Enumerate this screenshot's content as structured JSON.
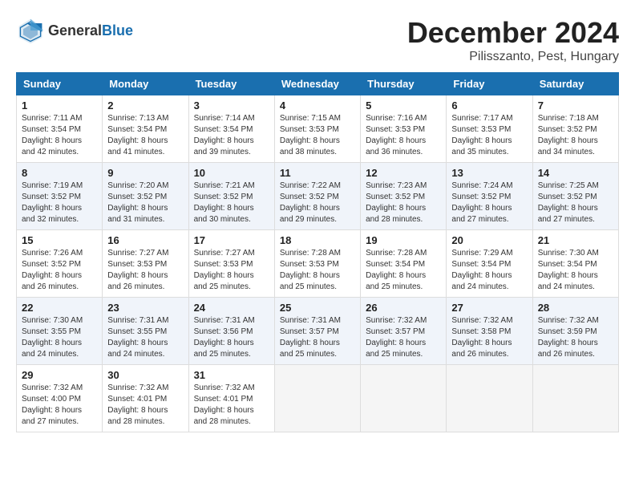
{
  "logo": {
    "general": "General",
    "blue": "Blue"
  },
  "header": {
    "month": "December 2024",
    "location": "Pilisszanto, Pest, Hungary"
  },
  "weekdays": [
    "Sunday",
    "Monday",
    "Tuesday",
    "Wednesday",
    "Thursday",
    "Friday",
    "Saturday"
  ],
  "weeks": [
    [
      {
        "day": "1",
        "info": "Sunrise: 7:11 AM\nSunset: 3:54 PM\nDaylight: 8 hours\nand 42 minutes."
      },
      {
        "day": "2",
        "info": "Sunrise: 7:13 AM\nSunset: 3:54 PM\nDaylight: 8 hours\nand 41 minutes."
      },
      {
        "day": "3",
        "info": "Sunrise: 7:14 AM\nSunset: 3:54 PM\nDaylight: 8 hours\nand 39 minutes."
      },
      {
        "day": "4",
        "info": "Sunrise: 7:15 AM\nSunset: 3:53 PM\nDaylight: 8 hours\nand 38 minutes."
      },
      {
        "day": "5",
        "info": "Sunrise: 7:16 AM\nSunset: 3:53 PM\nDaylight: 8 hours\nand 36 minutes."
      },
      {
        "day": "6",
        "info": "Sunrise: 7:17 AM\nSunset: 3:53 PM\nDaylight: 8 hours\nand 35 minutes."
      },
      {
        "day": "7",
        "info": "Sunrise: 7:18 AM\nSunset: 3:52 PM\nDaylight: 8 hours\nand 34 minutes."
      }
    ],
    [
      {
        "day": "8",
        "info": "Sunrise: 7:19 AM\nSunset: 3:52 PM\nDaylight: 8 hours\nand 32 minutes."
      },
      {
        "day": "9",
        "info": "Sunrise: 7:20 AM\nSunset: 3:52 PM\nDaylight: 8 hours\nand 31 minutes."
      },
      {
        "day": "10",
        "info": "Sunrise: 7:21 AM\nSunset: 3:52 PM\nDaylight: 8 hours\nand 30 minutes."
      },
      {
        "day": "11",
        "info": "Sunrise: 7:22 AM\nSunset: 3:52 PM\nDaylight: 8 hours\nand 29 minutes."
      },
      {
        "day": "12",
        "info": "Sunrise: 7:23 AM\nSunset: 3:52 PM\nDaylight: 8 hours\nand 28 minutes."
      },
      {
        "day": "13",
        "info": "Sunrise: 7:24 AM\nSunset: 3:52 PM\nDaylight: 8 hours\nand 27 minutes."
      },
      {
        "day": "14",
        "info": "Sunrise: 7:25 AM\nSunset: 3:52 PM\nDaylight: 8 hours\nand 27 minutes."
      }
    ],
    [
      {
        "day": "15",
        "info": "Sunrise: 7:26 AM\nSunset: 3:52 PM\nDaylight: 8 hours\nand 26 minutes."
      },
      {
        "day": "16",
        "info": "Sunrise: 7:27 AM\nSunset: 3:53 PM\nDaylight: 8 hours\nand 26 minutes."
      },
      {
        "day": "17",
        "info": "Sunrise: 7:27 AM\nSunset: 3:53 PM\nDaylight: 8 hours\nand 25 minutes."
      },
      {
        "day": "18",
        "info": "Sunrise: 7:28 AM\nSunset: 3:53 PM\nDaylight: 8 hours\nand 25 minutes."
      },
      {
        "day": "19",
        "info": "Sunrise: 7:28 AM\nSunset: 3:54 PM\nDaylight: 8 hours\nand 25 minutes."
      },
      {
        "day": "20",
        "info": "Sunrise: 7:29 AM\nSunset: 3:54 PM\nDaylight: 8 hours\nand 24 minutes."
      },
      {
        "day": "21",
        "info": "Sunrise: 7:30 AM\nSunset: 3:54 PM\nDaylight: 8 hours\nand 24 minutes."
      }
    ],
    [
      {
        "day": "22",
        "info": "Sunrise: 7:30 AM\nSunset: 3:55 PM\nDaylight: 8 hours\nand 24 minutes."
      },
      {
        "day": "23",
        "info": "Sunrise: 7:31 AM\nSunset: 3:55 PM\nDaylight: 8 hours\nand 24 minutes."
      },
      {
        "day": "24",
        "info": "Sunrise: 7:31 AM\nSunset: 3:56 PM\nDaylight: 8 hours\nand 25 minutes."
      },
      {
        "day": "25",
        "info": "Sunrise: 7:31 AM\nSunset: 3:57 PM\nDaylight: 8 hours\nand 25 minutes."
      },
      {
        "day": "26",
        "info": "Sunrise: 7:32 AM\nSunset: 3:57 PM\nDaylight: 8 hours\nand 25 minutes."
      },
      {
        "day": "27",
        "info": "Sunrise: 7:32 AM\nSunset: 3:58 PM\nDaylight: 8 hours\nand 26 minutes."
      },
      {
        "day": "28",
        "info": "Sunrise: 7:32 AM\nSunset: 3:59 PM\nDaylight: 8 hours\nand 26 minutes."
      }
    ],
    [
      {
        "day": "29",
        "info": "Sunrise: 7:32 AM\nSunset: 4:00 PM\nDaylight: 8 hours\nand 27 minutes."
      },
      {
        "day": "30",
        "info": "Sunrise: 7:32 AM\nSunset: 4:01 PM\nDaylight: 8 hours\nand 28 minutes."
      },
      {
        "day": "31",
        "info": "Sunrise: 7:32 AM\nSunset: 4:01 PM\nDaylight: 8 hours\nand 28 minutes."
      },
      {
        "day": "",
        "info": ""
      },
      {
        "day": "",
        "info": ""
      },
      {
        "day": "",
        "info": ""
      },
      {
        "day": "",
        "info": ""
      }
    ]
  ]
}
